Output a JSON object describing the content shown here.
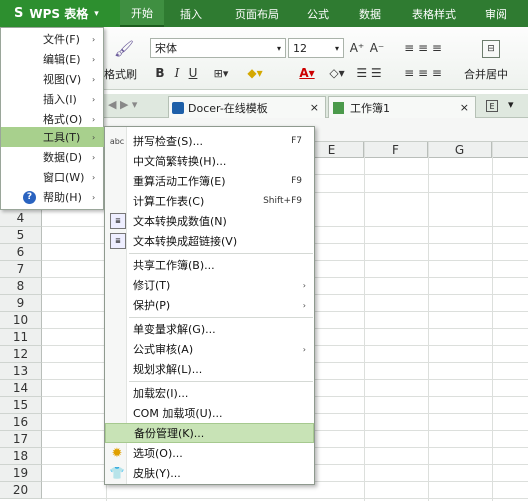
{
  "app": {
    "logo": "S",
    "name": "WPS 表格",
    "dropdown": "▾"
  },
  "ribbon_tabs": [
    "开始",
    "插入",
    "页面布局",
    "公式",
    "数据",
    "表格样式",
    "审阅"
  ],
  "ribbon": {
    "format_painter": "格式刷",
    "font_name": "宋体",
    "font_size": "12",
    "bold": "B",
    "italic": "I",
    "underline": "U",
    "merge_center": "合并居中",
    "grow_font": "A⁺",
    "shrink_font": "A⁻"
  },
  "doc_tabs": [
    {
      "label": "Docer-在线模板",
      "close": "×"
    },
    {
      "label": "工作簿1",
      "close": "×"
    }
  ],
  "columns": [
    "E",
    "F",
    "G"
  ],
  "rows": [
    "4",
    "5",
    "6",
    "7",
    "8",
    "9",
    "10",
    "11",
    "12",
    "13",
    "14",
    "15",
    "16",
    "17",
    "18",
    "19",
    "20"
  ],
  "app_menu": [
    {
      "label": "文件(F)",
      "arrow": "›"
    },
    {
      "label": "编辑(E)",
      "arrow": "›"
    },
    {
      "label": "视图(V)",
      "arrow": "›"
    },
    {
      "label": "插入(I)",
      "arrow": "›"
    },
    {
      "label": "格式(O)",
      "arrow": "›"
    },
    {
      "label": "工具(T)",
      "arrow": "›"
    },
    {
      "label": "数据(D)",
      "arrow": "›"
    },
    {
      "label": "窗口(W)",
      "arrow": "›"
    },
    {
      "label": "帮助(H)",
      "arrow": "›"
    }
  ],
  "tools_menu": {
    "spell_check": {
      "label": "拼写检查(S)...",
      "shortcut": "F7",
      "icon": "abc"
    },
    "simp_trad": {
      "label": "中文简繁转换(H)..."
    },
    "recalc_book": {
      "label": "重算活动工作簿(E)",
      "shortcut": "F9"
    },
    "calc_sheet": {
      "label": "计算工作表(C)",
      "shortcut": "Shift+F9"
    },
    "text_to_num": {
      "label": "文本转换成数值(N)"
    },
    "text_to_link": {
      "label": "文本转换成超链接(V)"
    },
    "share_book": {
      "label": "共享工作簿(B)..."
    },
    "revisions": {
      "label": "修订(T)",
      "arrow": "›"
    },
    "protect": {
      "label": "保护(P)",
      "arrow": "›"
    },
    "goal_seek": {
      "label": "单变量求解(G)..."
    },
    "formula_audit": {
      "label": "公式审核(A)",
      "arrow": "›"
    },
    "solver": {
      "label": "规划求解(L)..."
    },
    "addin_macro": {
      "label": "加载宏(I)..."
    },
    "com_addin": {
      "label": "COM 加载项(U)..."
    },
    "backup": {
      "label": "备份管理(K)..."
    },
    "options": {
      "label": "选项(O)..."
    },
    "skin": {
      "label": "皮肤(Y)..."
    }
  },
  "colors": {
    "topbar": "#2f7b31",
    "highlight": "#a8d08d"
  }
}
